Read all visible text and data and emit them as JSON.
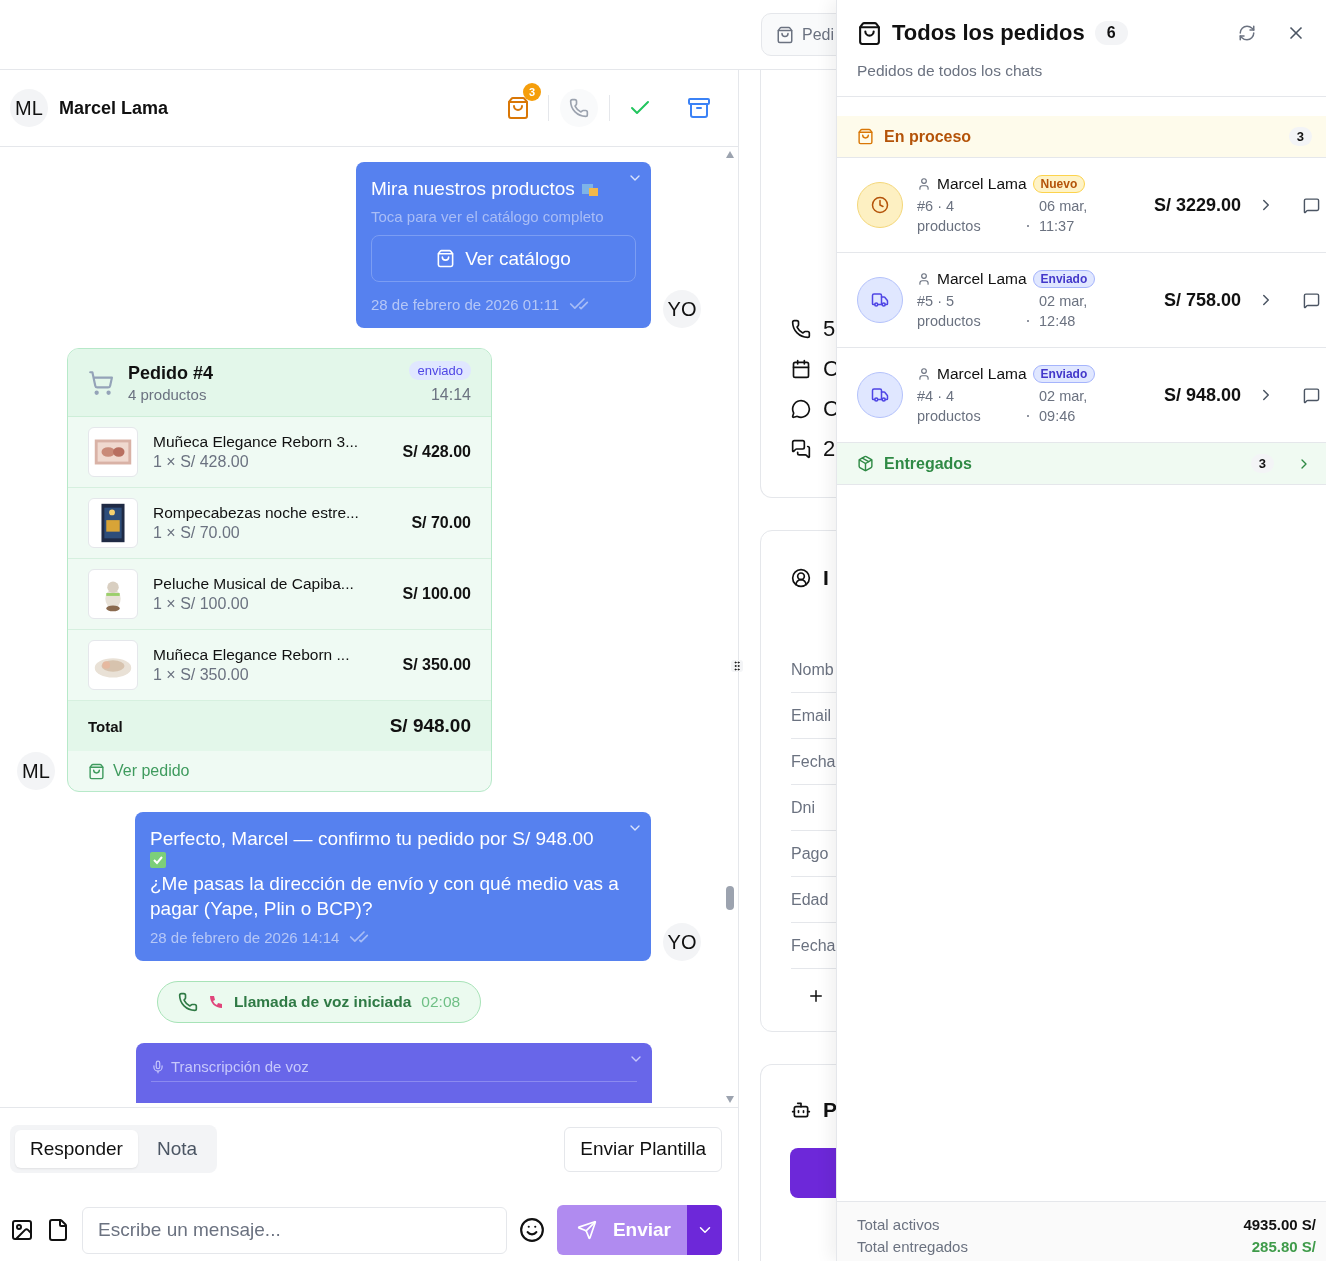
{
  "top_bar": {
    "orders_button": "Pedi"
  },
  "chat": {
    "contact": {
      "initials": "ML",
      "name": "Marcel Lama"
    },
    "cart_badge": "3",
    "messages": [
      {
        "kind": "catalog",
        "title": "Mira nuestros productos",
        "subtitle": "Toca para ver el catálogo completo",
        "button": "Ver catálogo",
        "time": "28 de febrero de 2026 01:11",
        "avatar": "YO"
      },
      {
        "kind": "order",
        "title": "Pedido #4",
        "count": "4 productos",
        "status": "enviado",
        "time": "14:14",
        "total_label": "Total",
        "total": "S/ 948.00",
        "link": "Ver pedido",
        "avatar": "ML",
        "items": [
          {
            "name": "Muñeca Elegance Reborn 3...",
            "qty_price": "1 × S/ 428.00",
            "subtotal": "S/ 428.00"
          },
          {
            "name": "Rompecabezas noche estre...",
            "qty_price": "1 × S/ 70.00",
            "subtotal": "S/ 70.00"
          },
          {
            "name": "Peluche Musical de Capiba...",
            "qty_price": "1 × S/ 100.00",
            "subtotal": "S/ 100.00"
          },
          {
            "name": "Muñeca Elegance Reborn ...",
            "qty_price": "1 × S/ 350.00",
            "subtotal": "S/ 350.00"
          }
        ]
      },
      {
        "kind": "text",
        "first_line": "Perfecto, Marcel — confirmo tu pedido por S/ 948.00",
        "second_line": "¿Me pasas la dirección de envío y con qué medio vas a pagar (Yape, Plin o BCP)?",
        "time": "28 de febrero de 2026 14:14",
        "avatar": "YO"
      },
      {
        "kind": "call",
        "text": "Llamada de voz iniciada",
        "duration": "02:08"
      },
      {
        "kind": "transcript",
        "title": "Transcripción de voz"
      }
    ]
  },
  "composer": {
    "tabs": [
      {
        "label": "Responder",
        "selected": true
      },
      {
        "label": "Nota",
        "selected": false
      }
    ],
    "template_button": "Enviar Plantilla",
    "placeholder": "Escribe un mensaje...",
    "send_button": "Enviar"
  },
  "contact_panel": {
    "stats": [
      {
        "kind": "phone",
        "text": "5"
      },
      {
        "kind": "calendar",
        "text": "C"
      },
      {
        "kind": "comment",
        "text": "C"
      },
      {
        "kind": "conversations",
        "text": "2"
      }
    ],
    "info_title": "I",
    "fields": [
      "Nomb",
      "Email",
      "Fecha",
      "Dni",
      "Pago",
      "Edad",
      "Fecha"
    ],
    "bot_title": "P"
  },
  "drawer": {
    "title": "Todos los pedidos",
    "count": "6",
    "subtitle": "Pedidos de todos los chats",
    "groups": [
      {
        "kind": "in_progress",
        "label": "En proceso",
        "count": "3",
        "expanded": true,
        "orders": [
          {
            "kind": "new",
            "customer": "Marcel Lama",
            "status": "Nuevo",
            "reference": "#6 · 4 productos",
            "date": "06 mar, 11:37",
            "total": "S/ 3229.00"
          },
          {
            "kind": "sent",
            "customer": "Marcel Lama",
            "status": "Enviado",
            "reference": "#5 · 5 productos",
            "date": "02 mar, 12:48",
            "total": "S/ 758.00"
          },
          {
            "kind": "sent",
            "customer": "Marcel Lama",
            "status": "Enviado",
            "reference": "#4 · 4 productos",
            "date": "02 mar, 09:46",
            "total": "S/ 948.00"
          }
        ]
      },
      {
        "kind": "delivered",
        "label": "Entregados",
        "count": "3",
        "expanded": false
      }
    ],
    "totals": [
      {
        "kind": "active",
        "label": "Total activos",
        "value": "4935.00 S/"
      },
      {
        "kind": "delivered",
        "label": "Total entregados",
        "value": "285.80 S/"
      }
    ]
  }
}
